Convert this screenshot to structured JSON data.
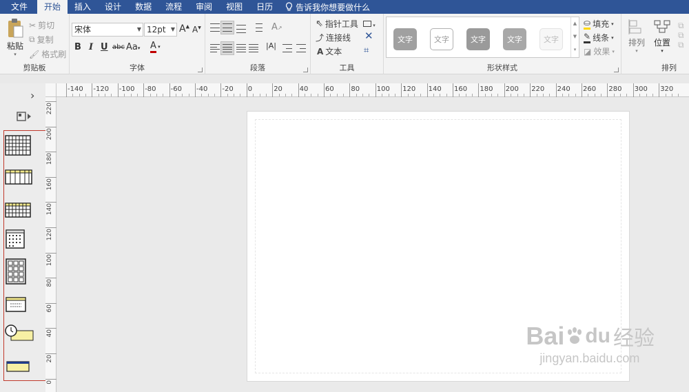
{
  "menu": {
    "tabs": [
      "文件",
      "开始",
      "插入",
      "设计",
      "数据",
      "流程",
      "审阅",
      "视图",
      "日历"
    ],
    "active_tab": "开始",
    "tell_me": "告诉我你想要做什么"
  },
  "ribbon": {
    "clipboard": {
      "paste": "粘贴",
      "cut": "剪切",
      "copy": "复制",
      "format_painter": "格式刷",
      "label": "剪贴板"
    },
    "font": {
      "family": "宋体",
      "size": "12pt",
      "bold": "B",
      "italic": "I",
      "underline": "U",
      "strike": "abc",
      "case": "Aa",
      "color": "A",
      "label": "字体"
    },
    "paragraph": {
      "label": "段落"
    },
    "tools": {
      "pointer": "指针工具",
      "connector": "连接线",
      "text": "文本",
      "label": "工具"
    },
    "shape_styles": {
      "swatch_text": "文字",
      "label": "形状样式",
      "fill": "填充",
      "line": "线条",
      "effect": "效果"
    },
    "arrange": {
      "arrange": "排列",
      "position": "位置",
      "label": "排列"
    }
  },
  "ruler": {
    "h_ticks": [
      "-140",
      "-120",
      "-100",
      "-80",
      "-60",
      "-40",
      "-20",
      "0",
      "20",
      "40",
      "60",
      "80",
      "100",
      "120",
      "140",
      "160",
      "180",
      "200",
      "220",
      "240",
      "260",
      "280",
      "300",
      "320"
    ],
    "v_ticks": [
      "220",
      "200",
      "180",
      "160",
      "140",
      "120",
      "100",
      "80",
      "60",
      "40",
      "20",
      "0"
    ]
  },
  "panel": {
    "expand": "›",
    "stencil_names": [
      "calendar-month-grid-icon",
      "calendar-week-icon",
      "calendar-multi-week-icon",
      "calendar-month-icon",
      "calendar-year-icon",
      "calendar-day-icon",
      "calendar-timeline-clock-icon",
      "calendar-bar-icon"
    ]
  },
  "watermark": {
    "brand": "Bai",
    "brand_suffix": "du",
    "cn": "经验",
    "url": "jingyan.baidu.com"
  }
}
